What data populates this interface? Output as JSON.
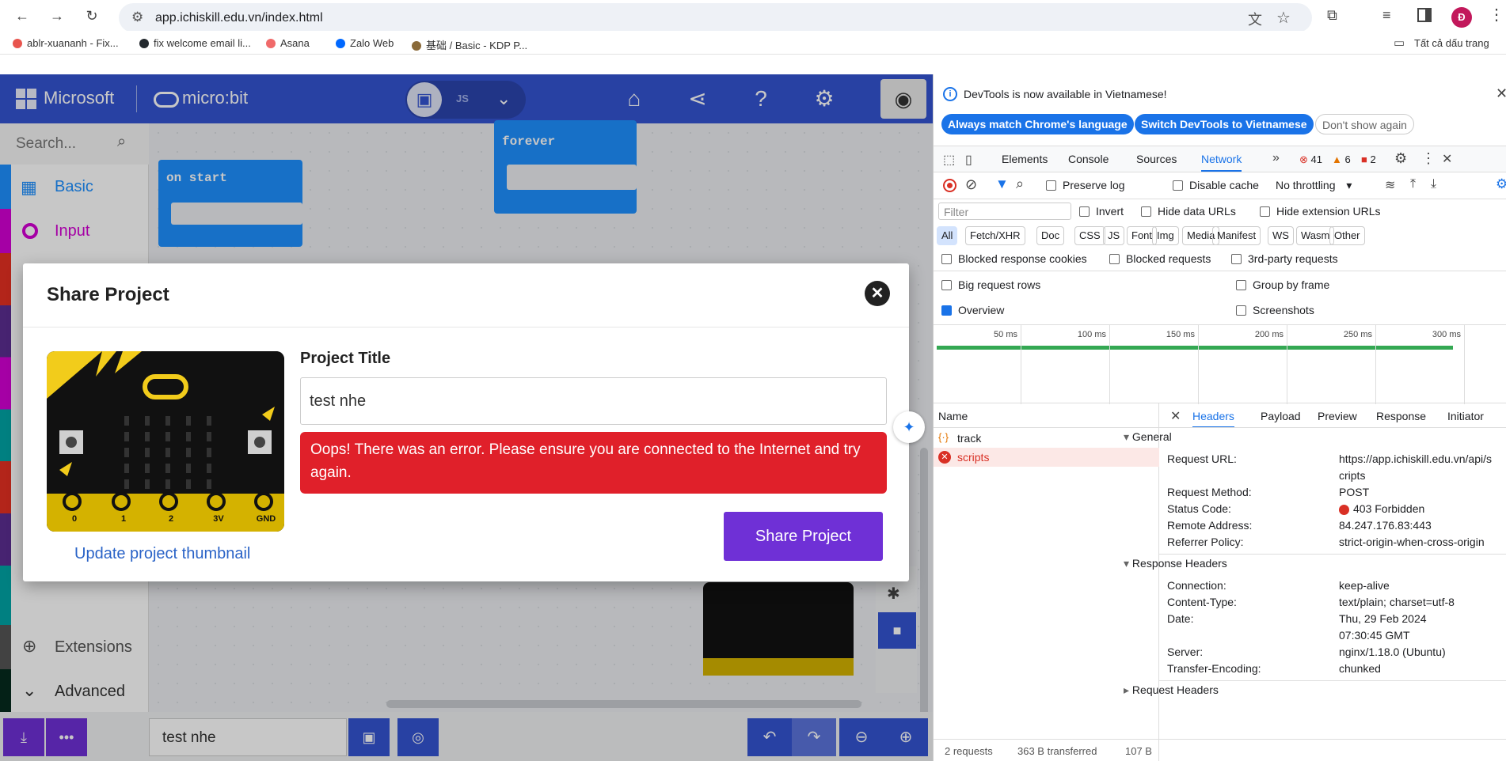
{
  "browser": {
    "url": "app.ichiskill.edu.vn/index.html",
    "profile_initial": "Đ",
    "bookmarks": [
      {
        "label": "ablr-xuananh - Fix...",
        "color": "#e8554e"
      },
      {
        "label": "fix welcome email li...",
        "color": "#24292e"
      },
      {
        "label": "Asana",
        "color": "#f06a6a"
      },
      {
        "label": "Zalo Web",
        "color": "#0068ff"
      },
      {
        "label": "基础 / Basic - KDP P...",
        "color": "#8a6a3a"
      }
    ],
    "all_bookmarks": "Tất cả dấu trang"
  },
  "makecode": {
    "brand_microsoft": "Microsoft",
    "brand_microbit": "micro:bit",
    "js_label": "JS",
    "search_placeholder": "Search...",
    "categories": [
      {
        "label": "Basic",
        "color": "#1e90ff"
      },
      {
        "label": "Input",
        "color": "#d400d4"
      },
      {
        "label": "Extensions",
        "color": "#555555"
      },
      {
        "label": "Advanced",
        "color": "#333333"
      }
    ],
    "blocks": {
      "on_start": "on start",
      "forever": "forever"
    },
    "project_name": "test nhe"
  },
  "modal": {
    "title": "Share Project",
    "project_title_label": "Project Title",
    "project_title_value": "test nhe",
    "error_message": "Oops! There was an error. Please ensure you are connected to the Internet and try again.",
    "share_button": "Share Project",
    "update_thumbnail": "Update project thumbnail",
    "pins": [
      "0",
      "1",
      "2",
      "3V",
      "GND"
    ]
  },
  "devtools": {
    "notice": "DevTools is now available in Vietnamese!",
    "btn_match": "Always match Chrome's language",
    "btn_switch": "Switch DevTools to Vietnamese",
    "btn_dismiss": "Don't show again",
    "tabs": [
      "Elements",
      "Console",
      "Sources",
      "Network"
    ],
    "active_tab": "Network",
    "errors": "41",
    "warnings": "6",
    "issues": "2",
    "preserve_log": "Preserve log",
    "disable_cache": "Disable cache",
    "throttling": "No throttling",
    "filter_placeholder": "Filter",
    "invert": "Invert",
    "hide_data_urls": "Hide data URLs",
    "hide_extension_urls": "Hide extension URLs",
    "type_filters": [
      "All",
      "Fetch/XHR",
      "Doc",
      "CSS",
      "JS",
      "Font",
      "Img",
      "Media",
      "Manifest",
      "WS",
      "Wasm",
      "Other"
    ],
    "blocked_cookies": "Blocked response cookies",
    "blocked_requests": "Blocked requests",
    "third_party": "3rd-party requests",
    "big_rows": "Big request rows",
    "group_by_frame": "Group by frame",
    "overview": "Overview",
    "screenshots": "Screenshots",
    "timeline_ticks": [
      "50 ms",
      "100 ms",
      "150 ms",
      "200 ms",
      "250 ms",
      "300 ms"
    ],
    "name_header": "Name",
    "requests": [
      {
        "name": "track",
        "status": "ok"
      },
      {
        "name": "scripts",
        "status": "error"
      }
    ],
    "detail_tabs": [
      "Headers",
      "Payload",
      "Preview",
      "Response",
      "Initiator"
    ],
    "general_label": "General",
    "general": [
      {
        "k": "Request URL:",
        "v": "https://app.ichiskill.edu.vn/api/s"
      },
      {
        "k": "",
        "v": "cripts"
      },
      {
        "k": "Request Method:",
        "v": "POST"
      },
      {
        "k": "Status Code:",
        "v": "403 Forbidden"
      },
      {
        "k": "Remote Address:",
        "v": "84.247.176.83:443"
      },
      {
        "k": "Referrer Policy:",
        "v": "strict-origin-when-cross-origin"
      }
    ],
    "response_headers_label": "Response Headers",
    "response_headers": [
      {
        "k": "Connection:",
        "v": "keep-alive"
      },
      {
        "k": "Content-Type:",
        "v": "text/plain; charset=utf-8"
      },
      {
        "k": "Date:",
        "v": "Thu, 29 Feb 2024"
      },
      {
        "k": "",
        "v": "07:30:45 GMT"
      },
      {
        "k": "Server:",
        "v": "nginx/1.18.0 (Ubuntu)"
      },
      {
        "k": "Transfer-Encoding:",
        "v": "chunked"
      }
    ],
    "request_headers_label": "Request Headers",
    "status_requests": "2 requests",
    "status_transferred": "363 B transferred",
    "status_size": "107 B"
  }
}
